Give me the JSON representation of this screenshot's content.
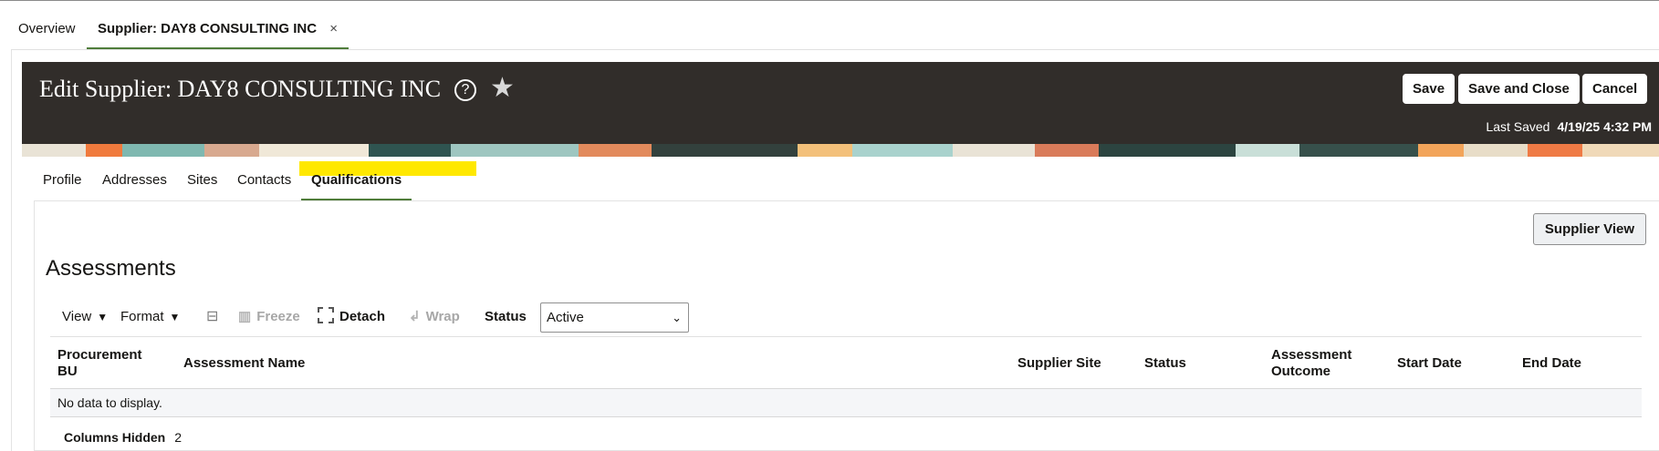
{
  "top_tabs": {
    "overview": "Overview",
    "active": "Supplier: DAY8 CONSULTING INC",
    "close_glyph": "×"
  },
  "header": {
    "title": "Edit Supplier: DAY8 CONSULTING INC",
    "help_glyph": "?",
    "favorite_glyph": "★",
    "save_label": "Save",
    "save_close_label": "Save and Close",
    "cancel_label": "Cancel",
    "last_saved_label": "Last Saved",
    "last_saved_value": "4/19/25 4:32 PM",
    "background": "#312d2a"
  },
  "sub_tabs": {
    "profile": "Profile",
    "addresses": "Addresses",
    "sites": "Sites",
    "contacts": "Contacts",
    "qualifications": "Qualifications",
    "active_indicator_color": "#4f7d3b",
    "highlight_color": "#ffe800"
  },
  "panel": {
    "supplier_view_label": "Supplier View",
    "section_title": "Assessments"
  },
  "toolbar": {
    "view_label": "View",
    "format_label": "Format",
    "freeze_label": "Freeze",
    "detach_label": "Detach",
    "wrap_label": "Wrap",
    "status_label": "Status",
    "status_value": "Active"
  },
  "table": {
    "headers": {
      "procurement_bu": "Procurement BU",
      "assessment_name": "Assessment Name",
      "supplier_site": "Supplier Site",
      "status": "Status",
      "assessment_outcome": "Assessment Outcome",
      "start_date": "Start Date",
      "end_date": "End Date"
    },
    "empty_text": "No data to display.",
    "columns_hidden_label": "Columns Hidden",
    "columns_hidden_count": "2"
  }
}
